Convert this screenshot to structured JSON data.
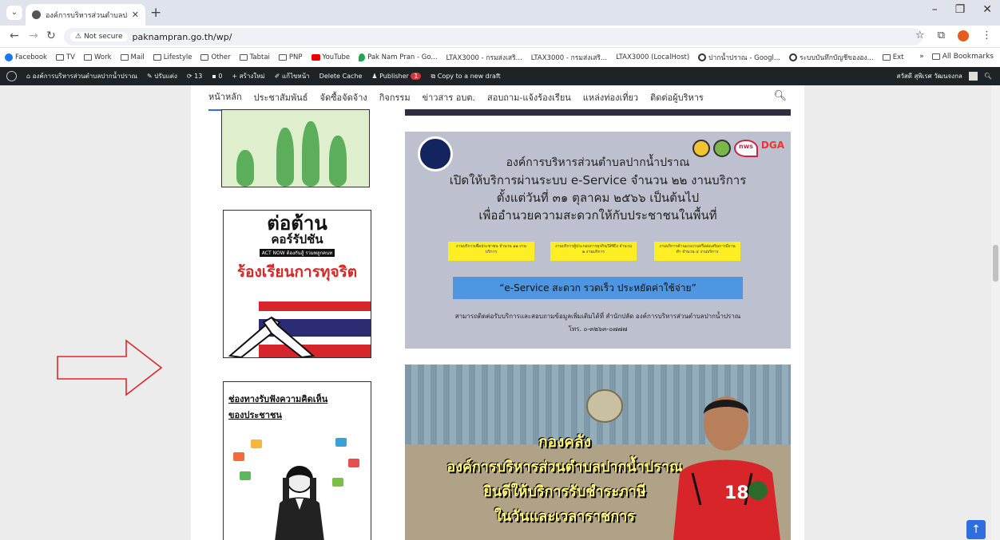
{
  "browser": {
    "tab_title": "องค์การบริหารส่วนตำบลปากน้ำปราณ",
    "not_secure": "Not secure",
    "url": "paknampran.go.th/wp/",
    "bookmarks": [
      "Facebook",
      "TV",
      "Work",
      "Mail",
      "Lifestyle",
      "Other",
      "Tabtai",
      "PNP",
      "YouTube",
      "Pak Nam Pran - Go...",
      "LTAX3000 - กรมส่งเสริ...",
      "LTAX3000 - กรมส่งเสริ...",
      "LTAX3000 (LocalHost)",
      "ปากน้ำปราณ - Googl...",
      "ระบบบันทึกบัญชีขององ...",
      "Ext"
    ],
    "all_bookmarks": "All Bookmarks"
  },
  "wp_admin": {
    "site_name": "องค์การบริหารส่วนตำบลปากน้ำปราณ",
    "customize": "ปรับแต่ง",
    "updates": "13",
    "comments": "0",
    "new": "สร้างใหม่",
    "edit": "แก้ไขหน้า",
    "delete_cache": "Delete Cache",
    "publisher": "Publisher",
    "publisher_badge": "1",
    "copy_draft": "Copy to a new draft",
    "howdy": "สวัสดี สุพิเรศ วัฒนจงกล"
  },
  "site_menu": [
    "หน้าหลัก",
    "ประชาสัมพันธ์",
    "จัดซื้อจัดจ้าง",
    "กิจกรรม",
    "ข่าวสาร อบต.",
    "สอบถาม-แจ้งร้องเรียน",
    "แหล่งท่องเที่ยว",
    "ติดต่อผู้บริหาร"
  ],
  "sidebar": {
    "anticorruption_line1": "ต่อต้าน",
    "anticorruption_line2": "คอร์รัปชัน",
    "act_now": "ACT NOW ต้องกันสู้ รวมพลูกคนท",
    "complain": "ร้องเรียนการทุจริต",
    "opinion_line1": "ช่องทางรับฟังความคิดเห็น",
    "opinion_line2": "ของประชาชน"
  },
  "banner_eservice": {
    "line1": "องค์การบริหารส่วนตำบลปากน้ำปราณ",
    "line2": "เปิดให้บริการผ่านระบบ e-Service จำนวน ๒๒ งานบริการ",
    "line3": "ตั้งแต่วันที่ ๓๑ ตุลาคม ๒๕๖๖ เป็นต้นไป",
    "line4": "เพื่ออำนวยความสะดวกให้กับประชาชนในพื้นที่",
    "pill1": "งานบริการเพื่อประชาชน จำนวน ๑๒ งานบริการ",
    "pill2": "งานบริการผู้ประกอบการธุรกิจ/SMEs จำนวน ๒ งานบริการ",
    "pill3": "งานบริการด้านแรงงานหรือส่งเสริมการมีงานทำ จำนวน ๔ งานบริการ",
    "slogan": "“e-Service สะดวก รวดเร็ว ประหยัดค่าใช้จ่าย”",
    "contact1": "สามารถติดต่อรับบริการและสอบถามข้อมูลเพิ่มเติมได้ที่ สำนักปลัด องค์การบริหารส่วนตำบลปากน้ำปราณ",
    "contact2": "โทร. ๐-๓๒๖๓-๐๗๗๗",
    "logo_nws": "nws",
    "logo_dga": "DGA"
  },
  "banner_tax": {
    "line1": "กองคลัง",
    "line2": "องค์การบริหารส่วนตำบลปากน้ำปราณ",
    "line3": "ยินดีให้บริการรับชำระภาษี",
    "line4": "ในวันและเวลาราชการ",
    "jersey_number": "18"
  },
  "colors": {
    "accent": "#2e6ee0",
    "wp_bar": "#1d2327",
    "arrow": "#e0262b"
  }
}
